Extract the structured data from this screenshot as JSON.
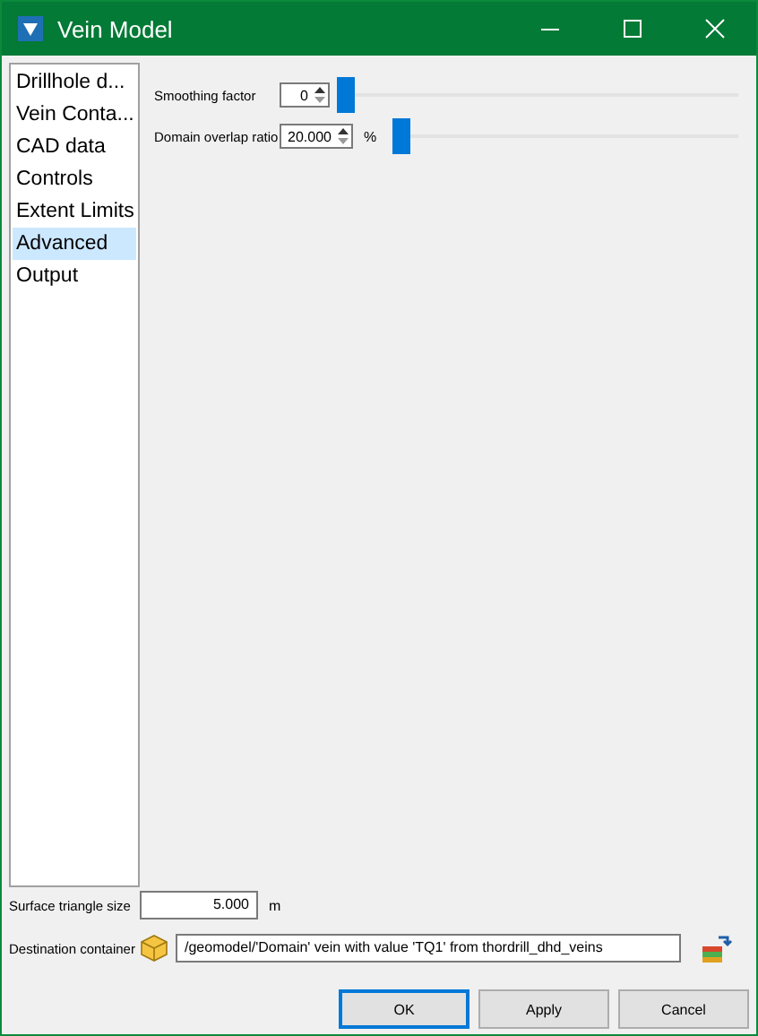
{
  "window": {
    "title": "Vein Model"
  },
  "sidebar": {
    "items": [
      {
        "label": "Drillhole d...",
        "selected": false
      },
      {
        "label": "Vein Conta...",
        "selected": false
      },
      {
        "label": "CAD data",
        "selected": false
      },
      {
        "label": "Controls",
        "selected": false
      },
      {
        "label": "Extent Limits",
        "selected": false
      },
      {
        "label": "Advanced",
        "selected": true
      },
      {
        "label": "Output",
        "selected": false
      }
    ]
  },
  "settings": [
    {
      "label": "Smoothing factor",
      "value": "0",
      "level": 0
    },
    {
      "label": "Domain overlap ratio",
      "value": "20.000",
      "unit": "%",
      "level": 0
    }
  ],
  "surface_triangle_size": {
    "label": "Surface triangle size",
    "value": "5.000",
    "unit": "m"
  },
  "destination_container": {
    "label": "Destination container",
    "value": "/geomodel/'Domain' vein with value 'TQ1' from thordrill_dhd_veins"
  },
  "buttons": [
    {
      "label": "OK",
      "default": true
    },
    {
      "label": "Apply",
      "default": false
    },
    {
      "label": "Cancel",
      "default": false
    }
  ]
}
